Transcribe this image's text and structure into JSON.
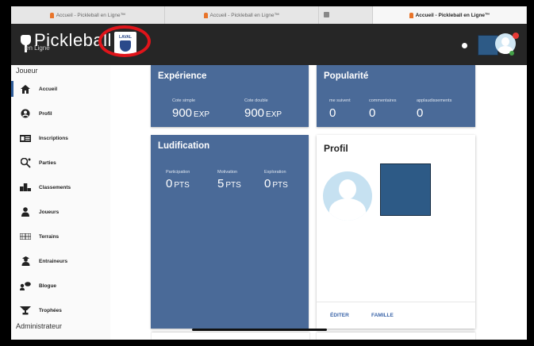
{
  "tabs": [
    {
      "label": "Accueil - Pickleball en Ligne™"
    },
    {
      "label": "Accueil - Pickleball en Ligne™"
    },
    {
      "label": ""
    },
    {
      "label": "Accueil - Pickleball en Ligne™"
    }
  ],
  "header": {
    "logo_text": "Pickleball",
    "logo_sub": "en Ligne",
    "badge_text": "LAVAL"
  },
  "sidebar": {
    "section_joueur": "Joueur",
    "section_admin": "Administrateur",
    "items": [
      {
        "label": "Accueil",
        "icon": "home-icon"
      },
      {
        "label": "Profil",
        "icon": "account-icon"
      },
      {
        "label": "Inscriptions",
        "icon": "id-card-icon"
      },
      {
        "label": "Parties",
        "icon": "paddle-icon"
      },
      {
        "label": "Classements",
        "icon": "podium-icon"
      },
      {
        "label": "Joueurs",
        "icon": "person-icon"
      },
      {
        "label": "Terrains",
        "icon": "court-icon"
      },
      {
        "label": "Entraineurs",
        "icon": "coach-icon"
      },
      {
        "label": "Blogue",
        "icon": "chat-icon"
      },
      {
        "label": "Trophées",
        "icon": "trophy-icon"
      }
    ]
  },
  "experience": {
    "title": "Expérience",
    "stats": [
      {
        "label": "Cote simple",
        "value": "900",
        "unit": "EXP"
      },
      {
        "label": "Cote double",
        "value": "900",
        "unit": "EXP"
      }
    ]
  },
  "popularite": {
    "title": "Popularité",
    "stats": [
      {
        "label": "me suivent",
        "value": "0"
      },
      {
        "label": "commentaires",
        "value": "0"
      },
      {
        "label": "applaudissements",
        "value": "0"
      }
    ]
  },
  "ludification": {
    "title": "Ludification",
    "stats": [
      {
        "label": "Participation",
        "value": "0",
        "unit": "PTS"
      },
      {
        "label": "Motivation",
        "value": "5",
        "unit": "PTS"
      },
      {
        "label": "Exploration",
        "value": "0",
        "unit": "PTS"
      }
    ]
  },
  "profil": {
    "title": "Profil",
    "edit_label": "ÉDITER",
    "family_label": "FAMILLE"
  },
  "colors": {
    "card_blue": "#4a6a98",
    "header_dark": "#262626",
    "accent_link": "#3a64a8",
    "highlight_ring": "#e0141a"
  }
}
